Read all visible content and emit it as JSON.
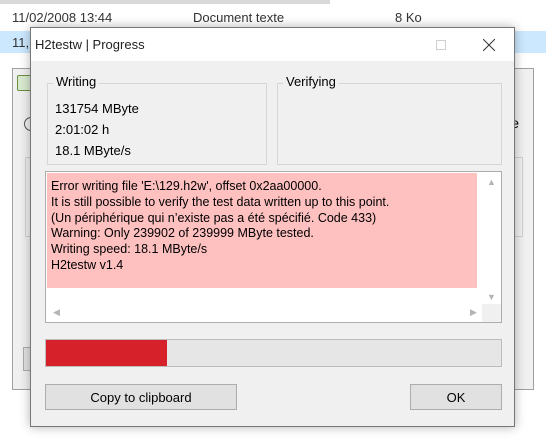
{
  "background": {
    "rows": [
      {
        "date": "11/02/2008 13:44",
        "type": "Document texte",
        "size": "8 Ko"
      },
      {
        "date": "11,",
        "type": "",
        "size": ""
      }
    ],
    "dialog_fragment": "e"
  },
  "window": {
    "title": "H2testw | Progress",
    "writing": {
      "label": "Writing",
      "megabytes": "131754 MByte",
      "time": "2:01:02 h",
      "speed": "18.1 MByte/s"
    },
    "verifying": {
      "label": "Verifying"
    },
    "log": "Error writing file 'E:\\129.h2w', offset 0x2aa00000.\nIt is still possible to verify the test data written up to this point.\n(Un périphérique qui n’existe pas a été spécifié. Code 433)\nWarning: Only 239902 of 239999 MByte tested.\nWriting speed: 18.1 MByte/s\nH2testw v1.4",
    "progress_fraction": 0.265,
    "progress_color": "#d6202a",
    "log_highlight_color": "#ffc0c0",
    "copy_button": "Copy to clipboard",
    "ok_button": "OK"
  }
}
